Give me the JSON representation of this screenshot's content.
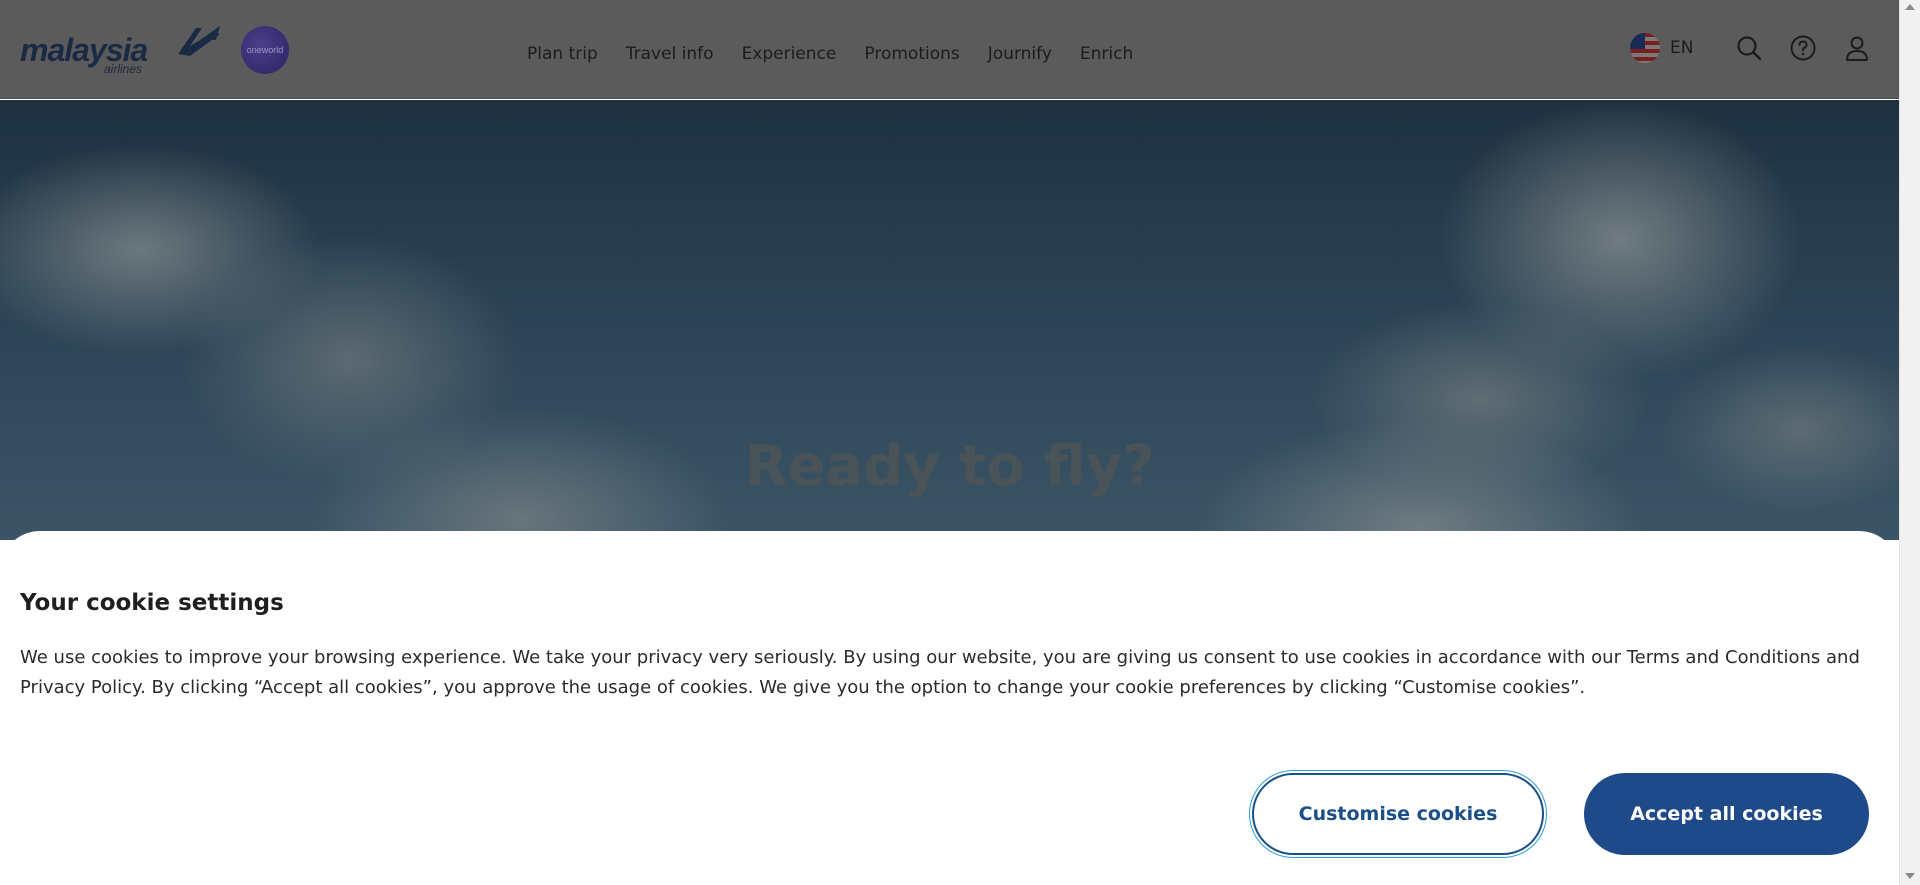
{
  "header": {
    "logo": {
      "text": "malaysia",
      "sub": "airlines"
    },
    "alliance": "oneworld",
    "nav": [
      {
        "label": "Plan trip"
      },
      {
        "label": "Travel info"
      },
      {
        "label": "Experience"
      },
      {
        "label": "Promotions"
      },
      {
        "label": "Journify"
      },
      {
        "label": "Enrich"
      }
    ],
    "language": {
      "flag": "malaysia-flag",
      "label": "EN"
    },
    "icons": [
      "search-icon",
      "help-icon",
      "user-icon"
    ]
  },
  "hero": {
    "title": "Ready to fly?"
  },
  "cookie": {
    "title": "Your cookie settings",
    "body": "We use cookies to improve your browsing experience. We take your privacy very seriously. By using our website, you are giving us consent to use cookies in accordance with our Terms and Conditions and Privacy Policy. By clicking “Accept all cookies”, you approve the usage of cookies. We give you the option to change your cookie preferences by clicking “Customise cookies”.",
    "customise_label": "Customise cookies",
    "accept_label": "Accept all cookies"
  },
  "colors": {
    "header_overlay": "#5b5b5b",
    "accent": "#1f4a8a",
    "focus_ring": "#2a9fd6"
  }
}
